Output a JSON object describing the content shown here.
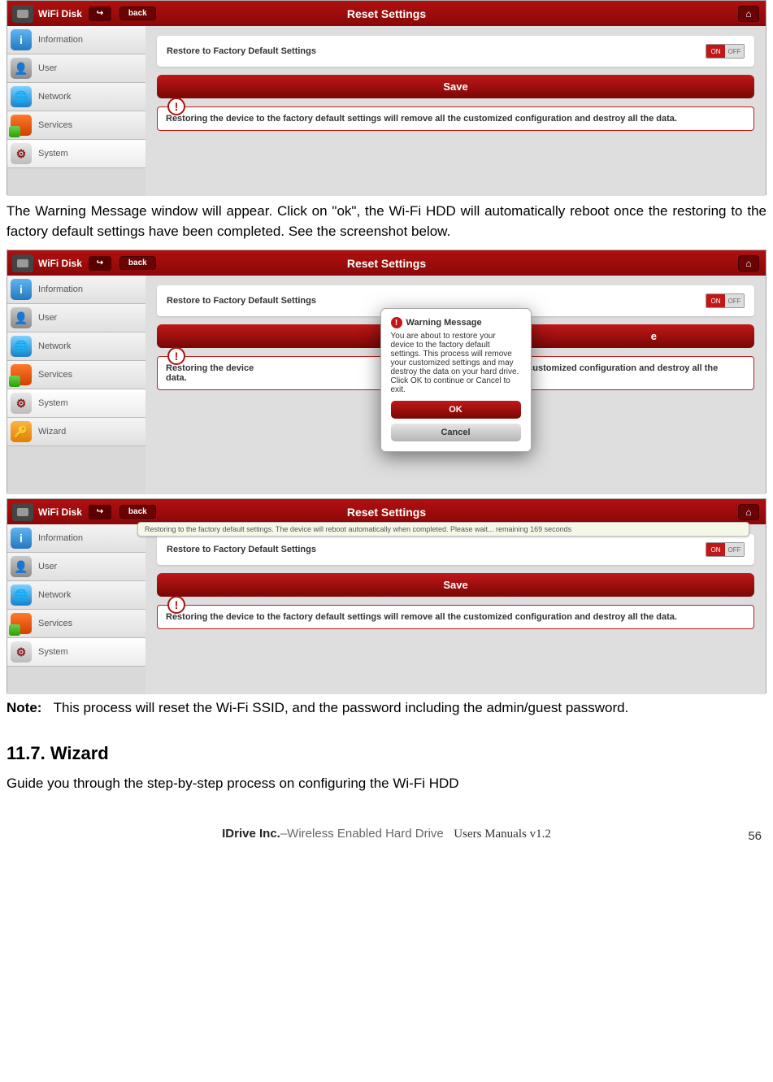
{
  "doc": {
    "para1": "The Warning Message window will appear. Click on \"ok\",   the Wi-Fi HDD will automatically reboot once the restoring to the factory default settings have been completed.   See the screenshot below.",
    "note_label": "Note:",
    "note_text": "This process will reset the Wi-Fi SSID, and the password including the admin/guest password.",
    "section_num": "11.7. Wizard",
    "section_body": "Guide you through the step-by-step process on configuring the Wi-Fi HDD",
    "footer_company": "IDrive Inc.",
    "footer_product": "–Wireless Enabled Hard Drive",
    "footer_manual": "Users Manuals v1.2",
    "page_number": "56"
  },
  "app": {
    "name": "WiFi Disk",
    "back": "back",
    "title": "Reset Settings",
    "sidebar": {
      "information": "Information",
      "user": "User",
      "network": "Network",
      "services": "Services",
      "system": "System",
      "wizard": "Wizard"
    },
    "panel_label": "Restore to Factory Default Settings",
    "toggle_on": "ON",
    "toggle_off": "OFF",
    "save": "Save",
    "warn": "Restoring the device to the factory default settings will remove all the customized configuration and destroy all the data."
  },
  "modal": {
    "title": "Warning Message",
    "body": "You are about to restore your device to the factory default settings. This process will remove your customized settings and may destroy the data on your hard drive. Click OK to continue or Cancel to exit.",
    "ok": "OK",
    "cancel": "Cancel"
  },
  "progress": {
    "text": "Restoring to the factory default settings. The device will reboot automatically when completed. Please wait... remaining 169 seconds"
  },
  "shot2": {
    "warn_partial1": "Restoring the device",
    "warn_partial2": "data.",
    "save_partial": "e",
    "warn_right": "ove all the customized configuration and destroy all the"
  }
}
